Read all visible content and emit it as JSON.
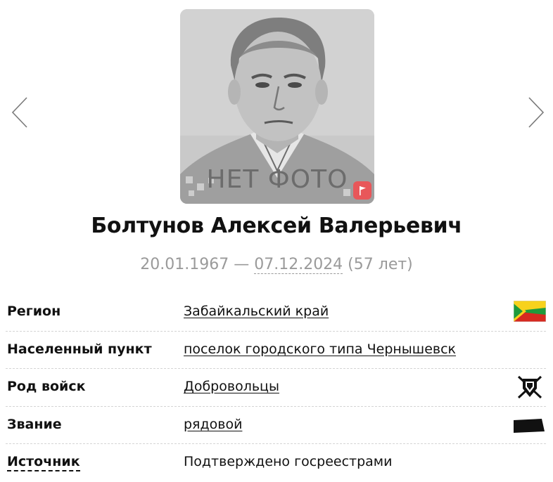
{
  "photo": {
    "placeholder_text": "НЕТ ФОТО",
    "badge_color": "#e8575a"
  },
  "person": {
    "name": "Болтунов Алексей Валерьевич",
    "birth_date": "20.01.1967",
    "separator": " — ",
    "death_date": "07.12.2024",
    "age": " (57 лет)"
  },
  "info": {
    "region": {
      "label": "Регион",
      "value": "Забайкальский край",
      "icon": "regional-flag-icon"
    },
    "locality": {
      "label": "Населенный пункт",
      "value": "поселок городского типа Чернышевск"
    },
    "branch": {
      "label": "Род войск",
      "value": "Добровольцы",
      "icon": "volunteers-emblem-icon"
    },
    "rank": {
      "label": "Звание",
      "value": "рядовой",
      "icon": "rank-insignia-icon"
    },
    "source": {
      "label": "Источник",
      "value": "Подтверждено госреестрами"
    }
  },
  "colors": {
    "flag_yellow": "#f7d21c",
    "flag_green": "#1e9b3c",
    "flag_red": "#d62a20",
    "date_gray": "#9a9a9a"
  }
}
